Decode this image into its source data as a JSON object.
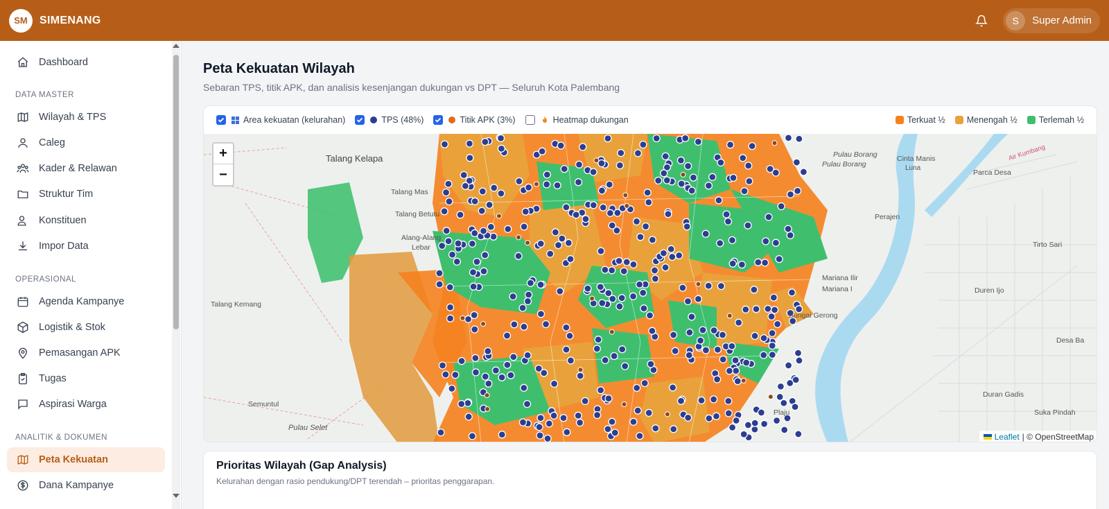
{
  "app": {
    "logo": "SM",
    "name": "SIMENANG"
  },
  "user": {
    "initial": "S",
    "name": "Super Admin"
  },
  "sidebar": {
    "dashboard": "Dashboard",
    "section_master": "DATA MASTER",
    "wilayah": "Wilayah & TPS",
    "caleg": "Caleg",
    "kader": "Kader & Relawan",
    "struktur": "Struktur Tim",
    "konstituen": "Konstituen",
    "impor": "Impor Data",
    "section_ops": "OPERASIONAL",
    "agenda": "Agenda Kampanye",
    "logistik": "Logistik & Stok",
    "apk": "Pemasangan APK",
    "tugas": "Tugas",
    "aspirasi": "Aspirasi Warga",
    "section_analitik": "ANALITIK & DOKUMEN",
    "peta": "Peta Kekuatan",
    "dana": "Dana Kampanye"
  },
  "page": {
    "title": "Peta Kekuatan Wilayah",
    "subtitle": "Sebaran TPS, titik APK, dan analisis kesenjangan dukungan vs DPT — Seluruh Kota Palembang"
  },
  "layers": {
    "area": "Area kekuatan (kelurahan)",
    "tps": "TPS (48%)",
    "apk": "Titik APK (3%)",
    "heatmap": "Heatmap dukungan",
    "terkuat": "Terkuat ½",
    "menengah": "Menengah ½",
    "terlemah": "Terlemah ½"
  },
  "colors": {
    "brand": "#b65e17",
    "terkuat": "#f5821f",
    "menengah": "#e9a23b",
    "terlemah": "#3fbf6e",
    "tps": "#2c3e91",
    "apk": "#e06d1a"
  },
  "map": {
    "zoom_in": "+",
    "zoom_out": "−",
    "labels": {
      "talang_kelapa": "Talang Kelapa",
      "talang_mas": "Talang Mas",
      "talang_betutu": "Talang Betutu",
      "alang_alang_1": "Alang-Alang",
      "alang_alang_2": "Lebar",
      "talang_kemang": "Talang Kemang",
      "semuntul": "Semuntul",
      "pulau_selet": "Pulau Selet",
      "pulau_borang_1": "Pulau Borang",
      "pulau_borang_2": "Pulau Borang",
      "cinta_manis_1": "Cinta Manis",
      "cinta_manis_2": "Luna",
      "parca_desa": "Parca Desa",
      "perajen": "Perajen",
      "tirto_sari": "Tirto Sari",
      "mariana_ilir": "Mariana Ilir",
      "mariana": "Mariana I",
      "duren_ijo": "Duren Ijo",
      "sungai_gerong": "Sungai Gerong",
      "desa_bar": "Desa Ba",
      "duran_gadis": "Duran Gadis",
      "suka_pindah": "Suka Pindah",
      "plaju": "Plaju",
      "road": "Air Kumbang"
    },
    "attribution_link": "Leaflet",
    "attribution_text": "| © OpenStreetMap"
  },
  "prioritas": {
    "title": "Prioritas Wilayah (Gap Analysis)",
    "subtitle": "Kelurahan dengan rasio pendukung/DPT terendah – prioritas penggarapan."
  }
}
